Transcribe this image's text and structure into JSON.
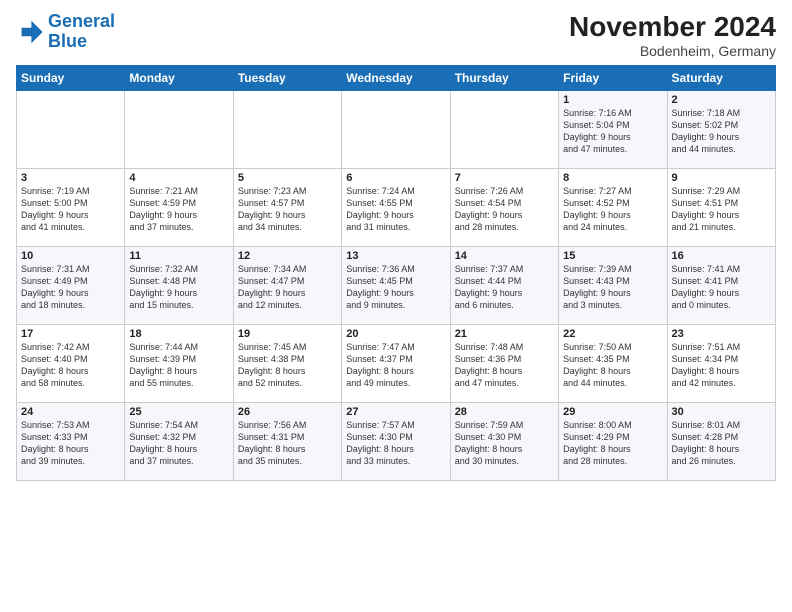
{
  "header": {
    "logo_line1": "General",
    "logo_line2": "Blue",
    "month_title": "November 2024",
    "location": "Bodenheim, Germany"
  },
  "weekdays": [
    "Sunday",
    "Monday",
    "Tuesday",
    "Wednesday",
    "Thursday",
    "Friday",
    "Saturday"
  ],
  "weeks": [
    [
      {
        "day": "",
        "info": ""
      },
      {
        "day": "",
        "info": ""
      },
      {
        "day": "",
        "info": ""
      },
      {
        "day": "",
        "info": ""
      },
      {
        "day": "",
        "info": ""
      },
      {
        "day": "1",
        "info": "Sunrise: 7:16 AM\nSunset: 5:04 PM\nDaylight: 9 hours\nand 47 minutes."
      },
      {
        "day": "2",
        "info": "Sunrise: 7:18 AM\nSunset: 5:02 PM\nDaylight: 9 hours\nand 44 minutes."
      }
    ],
    [
      {
        "day": "3",
        "info": "Sunrise: 7:19 AM\nSunset: 5:00 PM\nDaylight: 9 hours\nand 41 minutes."
      },
      {
        "day": "4",
        "info": "Sunrise: 7:21 AM\nSunset: 4:59 PM\nDaylight: 9 hours\nand 37 minutes."
      },
      {
        "day": "5",
        "info": "Sunrise: 7:23 AM\nSunset: 4:57 PM\nDaylight: 9 hours\nand 34 minutes."
      },
      {
        "day": "6",
        "info": "Sunrise: 7:24 AM\nSunset: 4:55 PM\nDaylight: 9 hours\nand 31 minutes."
      },
      {
        "day": "7",
        "info": "Sunrise: 7:26 AM\nSunset: 4:54 PM\nDaylight: 9 hours\nand 28 minutes."
      },
      {
        "day": "8",
        "info": "Sunrise: 7:27 AM\nSunset: 4:52 PM\nDaylight: 9 hours\nand 24 minutes."
      },
      {
        "day": "9",
        "info": "Sunrise: 7:29 AM\nSunset: 4:51 PM\nDaylight: 9 hours\nand 21 minutes."
      }
    ],
    [
      {
        "day": "10",
        "info": "Sunrise: 7:31 AM\nSunset: 4:49 PM\nDaylight: 9 hours\nand 18 minutes."
      },
      {
        "day": "11",
        "info": "Sunrise: 7:32 AM\nSunset: 4:48 PM\nDaylight: 9 hours\nand 15 minutes."
      },
      {
        "day": "12",
        "info": "Sunrise: 7:34 AM\nSunset: 4:47 PM\nDaylight: 9 hours\nand 12 minutes."
      },
      {
        "day": "13",
        "info": "Sunrise: 7:36 AM\nSunset: 4:45 PM\nDaylight: 9 hours\nand 9 minutes."
      },
      {
        "day": "14",
        "info": "Sunrise: 7:37 AM\nSunset: 4:44 PM\nDaylight: 9 hours\nand 6 minutes."
      },
      {
        "day": "15",
        "info": "Sunrise: 7:39 AM\nSunset: 4:43 PM\nDaylight: 9 hours\nand 3 minutes."
      },
      {
        "day": "16",
        "info": "Sunrise: 7:41 AM\nSunset: 4:41 PM\nDaylight: 9 hours\nand 0 minutes."
      }
    ],
    [
      {
        "day": "17",
        "info": "Sunrise: 7:42 AM\nSunset: 4:40 PM\nDaylight: 8 hours\nand 58 minutes."
      },
      {
        "day": "18",
        "info": "Sunrise: 7:44 AM\nSunset: 4:39 PM\nDaylight: 8 hours\nand 55 minutes."
      },
      {
        "day": "19",
        "info": "Sunrise: 7:45 AM\nSunset: 4:38 PM\nDaylight: 8 hours\nand 52 minutes."
      },
      {
        "day": "20",
        "info": "Sunrise: 7:47 AM\nSunset: 4:37 PM\nDaylight: 8 hours\nand 49 minutes."
      },
      {
        "day": "21",
        "info": "Sunrise: 7:48 AM\nSunset: 4:36 PM\nDaylight: 8 hours\nand 47 minutes."
      },
      {
        "day": "22",
        "info": "Sunrise: 7:50 AM\nSunset: 4:35 PM\nDaylight: 8 hours\nand 44 minutes."
      },
      {
        "day": "23",
        "info": "Sunrise: 7:51 AM\nSunset: 4:34 PM\nDaylight: 8 hours\nand 42 minutes."
      }
    ],
    [
      {
        "day": "24",
        "info": "Sunrise: 7:53 AM\nSunset: 4:33 PM\nDaylight: 8 hours\nand 39 minutes."
      },
      {
        "day": "25",
        "info": "Sunrise: 7:54 AM\nSunset: 4:32 PM\nDaylight: 8 hours\nand 37 minutes."
      },
      {
        "day": "26",
        "info": "Sunrise: 7:56 AM\nSunset: 4:31 PM\nDaylight: 8 hours\nand 35 minutes."
      },
      {
        "day": "27",
        "info": "Sunrise: 7:57 AM\nSunset: 4:30 PM\nDaylight: 8 hours\nand 33 minutes."
      },
      {
        "day": "28",
        "info": "Sunrise: 7:59 AM\nSunset: 4:30 PM\nDaylight: 8 hours\nand 30 minutes."
      },
      {
        "day": "29",
        "info": "Sunrise: 8:00 AM\nSunset: 4:29 PM\nDaylight: 8 hours\nand 28 minutes."
      },
      {
        "day": "30",
        "info": "Sunrise: 8:01 AM\nSunset: 4:28 PM\nDaylight: 8 hours\nand 26 minutes."
      }
    ]
  ]
}
